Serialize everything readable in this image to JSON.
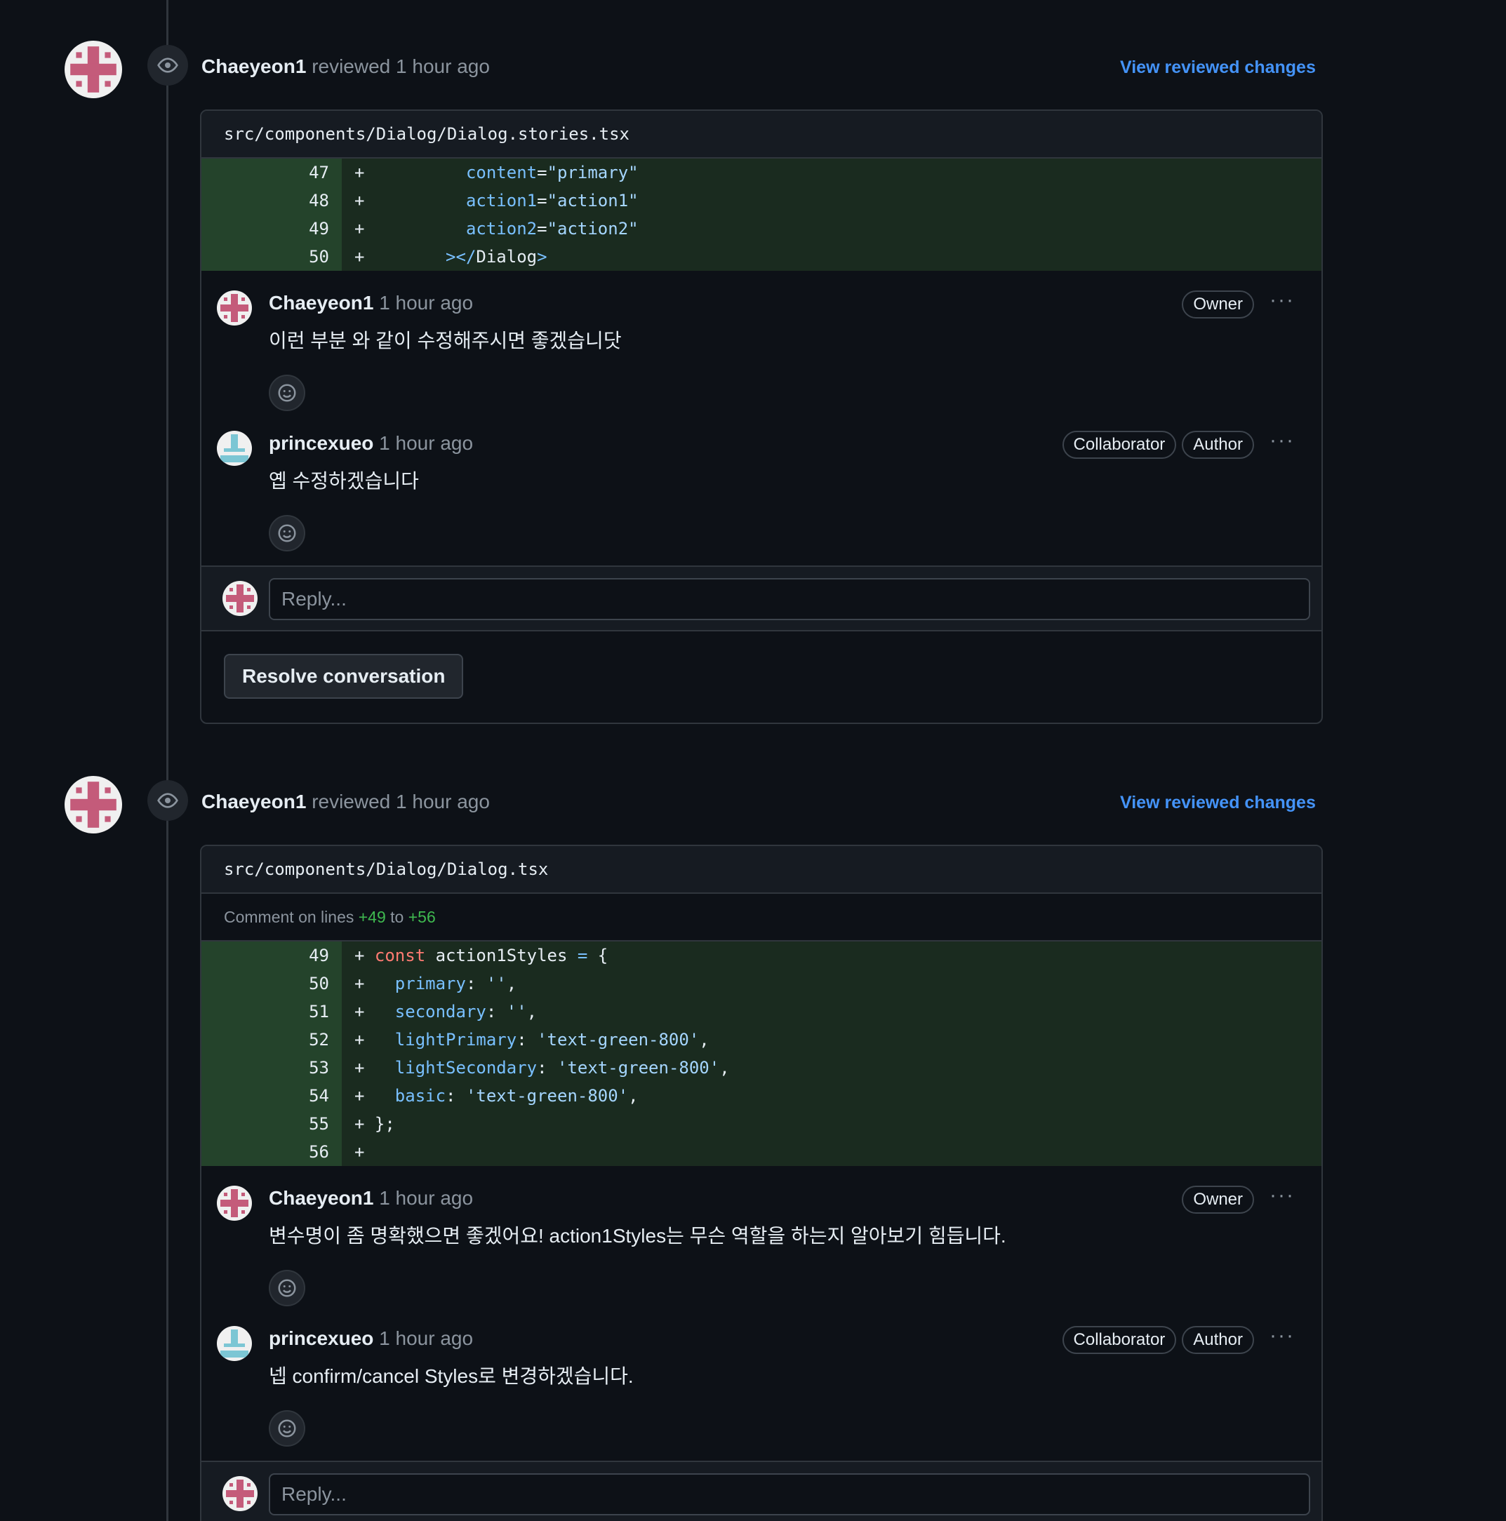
{
  "colors": {
    "background": "#0d1117",
    "link": "#4493f8",
    "added_line": "#1a2b1f",
    "avatar_pink": "#c45b7a",
    "avatar_teal": "#7cc6d4"
  },
  "reviews": [
    {
      "reviewer": "Chaeyeon1",
      "action": "reviewed",
      "time": "1 hour ago",
      "view_link": "View reviewed changes",
      "file": "src/components/Dialog/Dialog.stories.tsx",
      "diff": [
        {
          "line": "47",
          "code": "+          content=\"primary\""
        },
        {
          "line": "48",
          "code": "+          action1=\"action1\""
        },
        {
          "line": "49",
          "code": "+          action2=\"action2\""
        },
        {
          "line": "50",
          "code": "+        ></Dialog>"
        }
      ],
      "comments": [
        {
          "author": "Chaeyeon1",
          "time": "1 hour ago",
          "badges": [
            "Owner"
          ],
          "body": "이런 부분 와 같이 수정해주시면 좋겠습니닷"
        },
        {
          "author": "princexueo",
          "time": "1 hour ago",
          "badges": [
            "Collaborator",
            "Author"
          ],
          "body": "옙 수정하겠습니다"
        }
      ],
      "reply_placeholder": "Reply...",
      "resolve_label": "Resolve conversation"
    },
    {
      "reviewer": "Chaeyeon1",
      "action": "reviewed",
      "time": "1 hour ago",
      "view_link": "View reviewed changes",
      "file": "src/components/Dialog/Dialog.tsx",
      "comment_on": {
        "prefix": "Comment on lines",
        "from": "+49",
        "mid": "to",
        "to": "+56"
      },
      "diff": [
        {
          "line": "49",
          "code": "+ const action1Styles = {"
        },
        {
          "line": "50",
          "code": "+   primary: '',"
        },
        {
          "line": "51",
          "code": "+   secondary: '',"
        },
        {
          "line": "52",
          "code": "+   lightPrimary: 'text-green-800',"
        },
        {
          "line": "53",
          "code": "+   lightSecondary: 'text-green-800',"
        },
        {
          "line": "54",
          "code": "+   basic: 'text-green-800',"
        },
        {
          "line": "55",
          "code": "+ };"
        },
        {
          "line": "56",
          "code": "+"
        }
      ],
      "comments": [
        {
          "author": "Chaeyeon1",
          "time": "1 hour ago",
          "badges": [
            "Owner"
          ],
          "body": "변수명이 좀 명확했으면 좋겠어요! action1Styles는 무슨 역할을 하는지 알아보기 힘듭니다."
        },
        {
          "author": "princexueo",
          "time": "1 hour ago",
          "badges": [
            "Collaborator",
            "Author"
          ],
          "body": "넵 confirm/cancel Styles로 변경하겠습니다."
        }
      ],
      "reply_placeholder": "Reply..."
    }
  ],
  "icons": {
    "review": "eye-icon",
    "reaction": "smiley-icon",
    "more": "kebab-horizontal-icon"
  }
}
